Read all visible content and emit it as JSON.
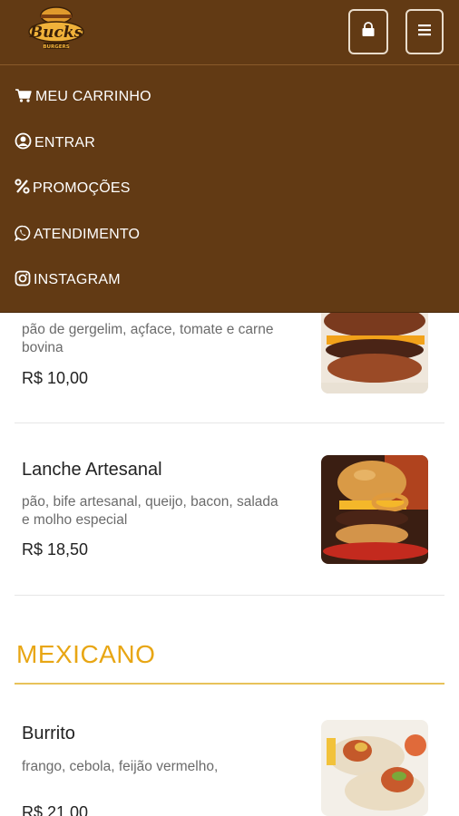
{
  "header": {
    "logo_text": "Bucks",
    "logo_sub": "BURGERS"
  },
  "icons": {
    "bag": "shopping-bag-icon",
    "menu": "hamburger-menu-icon"
  },
  "menu": {
    "items": [
      {
        "label": "MEU CARRINHO",
        "icon": "cart-icon"
      },
      {
        "label": "ENTRAR",
        "icon": "user-circle-icon"
      },
      {
        "label": "PROMOÇÕES",
        "icon": "percent-icon"
      },
      {
        "label": "ATENDIMENTO",
        "icon": "whatsapp-icon"
      },
      {
        "label": "INSTAGRAM",
        "icon": "instagram-icon"
      }
    ]
  },
  "products": [
    {
      "name": "",
      "description": "pão de gergelim, açface, tomate e carne bovina",
      "price": "R$ 10,00"
    },
    {
      "name": "Lanche Artesanal",
      "description": "pão, bife artesanal, queijo, bacon, salada e molho especial",
      "price": "R$ 18,50"
    },
    {
      "name": "Burrito",
      "description": "frango, cebola, feijão vermelho,",
      "price": "R$ 21,00"
    }
  ],
  "categories": {
    "mexicano": "MEXICANO"
  },
  "colors": {
    "brand_brown": "#623a14",
    "accent_yellow": "#e8a614"
  }
}
